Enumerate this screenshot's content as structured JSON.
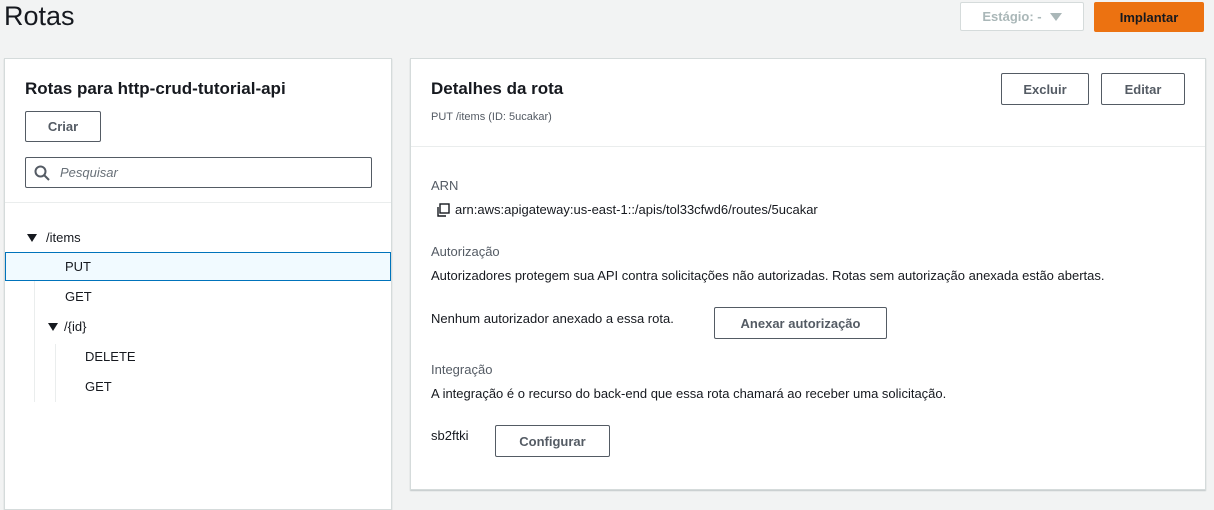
{
  "page": {
    "title": "Rotas"
  },
  "header": {
    "stage_label": "Estágio: -",
    "deploy_label": "Implantar"
  },
  "routes_panel": {
    "title": "Rotas para http-crud-tutorial-api",
    "create_label": "Criar",
    "search_placeholder": "Pesquisar",
    "tree": {
      "items_path": "/items",
      "items_put": "PUT",
      "items_get": "GET",
      "id_path": "/{id}",
      "id_delete": "DELETE",
      "id_get": "GET"
    }
  },
  "details_panel": {
    "title": "Detalhes da rota",
    "subtitle": "PUT /items (ID: 5ucakar)",
    "delete_label": "Excluir",
    "edit_label": "Editar",
    "arn_label": "ARN",
    "arn_value": "arn:aws:apigateway:us-east-1::/apis/tol33cfwd6/routes/5ucakar",
    "auth_label": "Autorização",
    "auth_description": "Autorizadores protegem sua API contra solicitações não autorizadas. Rotas sem autorização anexada estão abertas.",
    "auth_status": "Nenhum autorizador anexado a essa rota.",
    "attach_auth_label": "Anexar autorização",
    "integration_label": "Integração",
    "integration_description": "A integração é o recurso do back-end que essa rota chamará ao receber uma solicitação.",
    "integration_id": "sb2ftki",
    "configure_label": "Configurar"
  },
  "colors": {
    "accent_orange": "#ec7211",
    "selected_border": "#0073bb",
    "background": "#f2f3f3"
  }
}
